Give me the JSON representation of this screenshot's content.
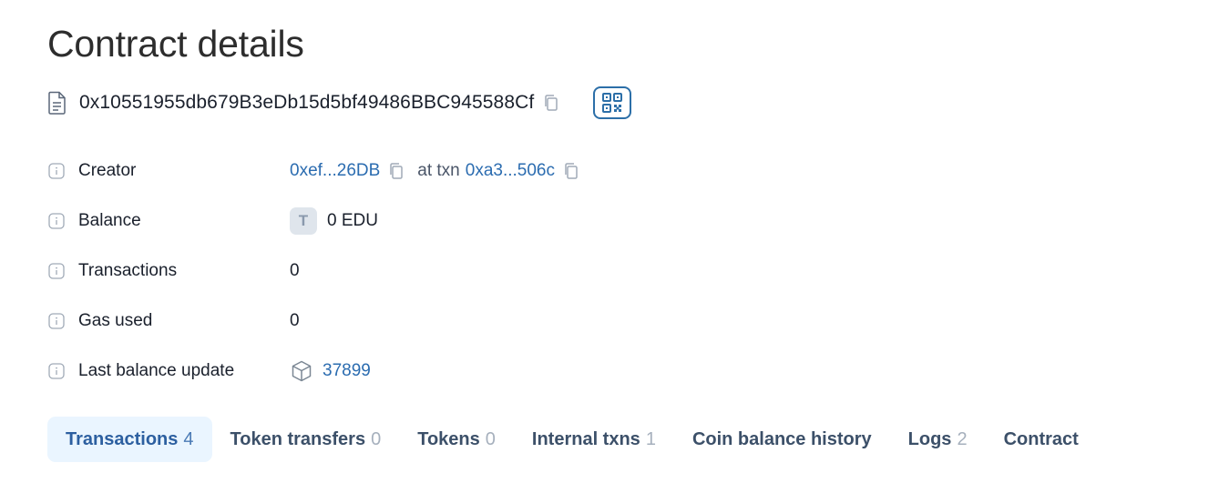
{
  "page": {
    "title": "Contract details"
  },
  "address": {
    "value": "0x10551955db679B3eDb15d5bf49486BBC945588Cf"
  },
  "details": {
    "creator": {
      "label": "Creator",
      "address": "0xef...26DB",
      "at_txn_label": "at txn",
      "txn": "0xa3...506c"
    },
    "balance": {
      "label": "Balance",
      "token_badge": "T",
      "value": "0 EDU"
    },
    "transactions": {
      "label": "Transactions",
      "value": "0"
    },
    "gas_used": {
      "label": "Gas used",
      "value": "0"
    },
    "last_balance_update": {
      "label": "Last balance update",
      "value": "37899"
    }
  },
  "tabs": [
    {
      "label": "Transactions",
      "count": "4",
      "active": true
    },
    {
      "label": "Token transfers",
      "count": "0"
    },
    {
      "label": "Tokens",
      "count": "0"
    },
    {
      "label": "Internal txns",
      "count": "1"
    },
    {
      "label": "Coin balance history",
      "count": ""
    },
    {
      "label": "Logs",
      "count": "2"
    },
    {
      "label": "Contract",
      "count": ""
    }
  ],
  "colors": {
    "link": "#2b6cb0",
    "active_tab_bg": "#eaf5ff",
    "qr_border": "#2c6fa8"
  },
  "icons": {
    "address": "contract-document-icon",
    "copy": "copy-icon",
    "qr": "qr-code-icon",
    "info": "info-icon",
    "block": "block-cube-icon"
  }
}
